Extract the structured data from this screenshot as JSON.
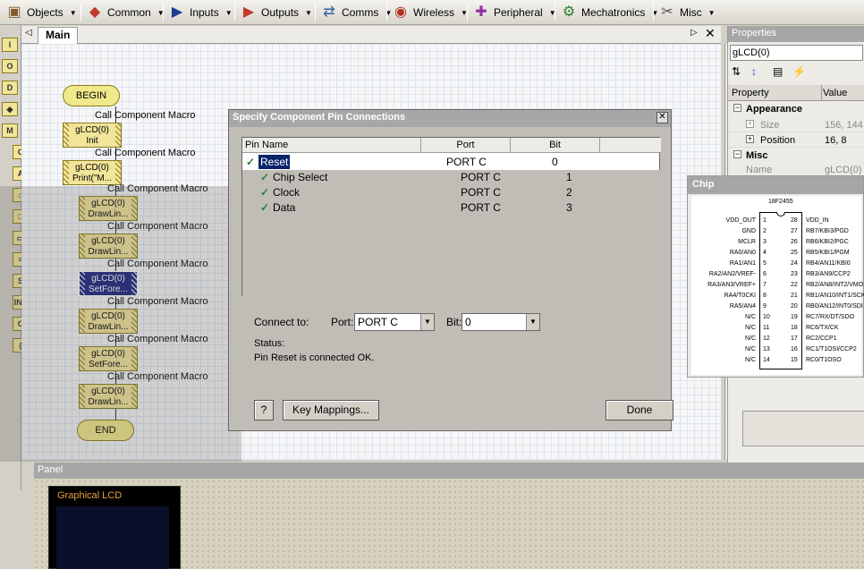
{
  "toolbar": {
    "items": [
      {
        "label": "Objects",
        "icon": "objects-icon",
        "color": "#8a5a2b"
      },
      {
        "label": "Common",
        "icon": "common-icon",
        "color": "#c0392b"
      },
      {
        "label": "Inputs",
        "icon": "inputs-icon",
        "color": "#1f3a93"
      },
      {
        "label": "Outputs",
        "icon": "outputs-icon",
        "color": "#c0392b"
      },
      {
        "label": "Comms",
        "icon": "comms-icon",
        "color": "#2e5fa8"
      },
      {
        "label": "Wireless",
        "icon": "wireless-icon",
        "color": "#b0341f"
      },
      {
        "label": "Peripheral",
        "icon": "peripheral-icon",
        "color": "#8e2fa0"
      },
      {
        "label": "Mechatronics",
        "icon": "mechatronics-icon",
        "color": "#2f7d32"
      },
      {
        "label": "Misc",
        "icon": "misc-icon",
        "color": "#555555"
      }
    ]
  },
  "palette": {
    "icons": [
      "I",
      "O",
      "D",
      "◆",
      "M",
      "C",
      "A",
      "⌂",
      "□",
      "▭",
      "≡",
      "S",
      "INT",
      "C",
      "{"
    ]
  },
  "tabs": {
    "main": "Main"
  },
  "flowchart": {
    "begin": "BEGIN",
    "end": "END",
    "macro_caption": "Call Component Macro",
    "blocks": [
      {
        "line1": "gLCD(0)",
        "line2": "Init"
      },
      {
        "line1": "gLCD(0)",
        "line2": "Print(\"M..."
      },
      {
        "line1": "gLCD(0)",
        "line2": "DrawLin..."
      },
      {
        "line1": "gLCD(0)",
        "line2": "DrawLin..."
      },
      {
        "line1": "gLCD(0)",
        "line2": "SetFore..."
      },
      {
        "line1": "gLCD(0)",
        "line2": "DrawLin..."
      },
      {
        "line1": "gLCD(0)",
        "line2": "SetFore..."
      },
      {
        "line1": "gLCD(0)",
        "line2": "DrawLin..."
      }
    ]
  },
  "properties": {
    "title": "Properties",
    "object": "gLCD(0)",
    "col_property": "Property",
    "col_value": "Value",
    "groups": [
      {
        "name": "Appearance",
        "rows": [
          {
            "name": "Size",
            "value": "156, 144"
          },
          {
            "name": "Position",
            "value": "16, 8"
          }
        ]
      },
      {
        "name": "Misc",
        "rows": [
          {
            "name": "Name",
            "value": "gLCD(0)"
          }
        ]
      }
    ]
  },
  "dialog": {
    "title": "Specify Component Pin Connections",
    "columns": {
      "pin": "Pin Name",
      "port": "Port",
      "bit": "Bit"
    },
    "pins": [
      {
        "name": "Reset",
        "port": "PORT C",
        "bit": "0"
      },
      {
        "name": "Chip Select",
        "port": "PORT C",
        "bit": "1"
      },
      {
        "name": "Clock",
        "port": "PORT C",
        "bit": "2"
      },
      {
        "name": "Data",
        "port": "PORT C",
        "bit": "3"
      }
    ],
    "connect_label": "Connect to:",
    "port_label": "Port:",
    "port_value": "PORT C",
    "bit_label": "Bit:",
    "bit_value": "0",
    "status_label": "Status:",
    "status_text": "Pin Reset is connected OK.",
    "help_btn": "?",
    "keymap_btn": "Key Mappings...",
    "done_btn": "Done"
  },
  "chip": {
    "title": "Chip",
    "part": "18F2455",
    "left_pins": [
      "VDD_OUT",
      "GND",
      "MCLR",
      "RA0/AN0",
      "RA1/AN1",
      "RA2/AN2/VREF-",
      "RA3/AN3/VREF+",
      "RA4/T0CKI",
      "RA5/AN4",
      "N/C",
      "N/C",
      "N/C",
      "N/C",
      "N/C"
    ],
    "right_pins": [
      "VDD_IN",
      "RB7/KBI3/PGD",
      "RB6/KBI2/PGC",
      "RB5/KBI1/PGM",
      "RB4/AN11/KBI0",
      "RB3/AN9/CCP2",
      "RB2/AN8/INT2/VMO",
      "RB1/AN10/INT1/SCK",
      "RB0/AN12/INT0/SDI",
      "RC7/RX/DT/SDO",
      "RC6/TX/CK",
      "RC2/CCP1",
      "RC1/T1OSI/CCP2",
      "RC0/T1OSO"
    ]
  },
  "panel": {
    "title": "Panel",
    "lcd_label": "Graphical LCD"
  }
}
